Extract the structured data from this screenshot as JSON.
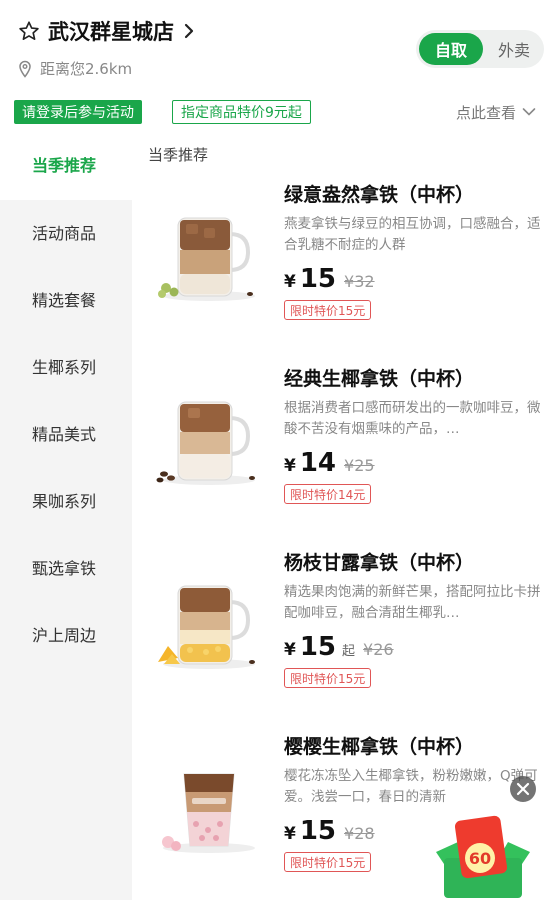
{
  "header": {
    "store_name": "武汉群星城店",
    "distance": "距离您2.6km",
    "modes": {
      "self": "自取",
      "delivery": "外卖"
    },
    "badge_login": "请登录后参与活动",
    "badge_promo": "指定商品特价9元起",
    "view_more": "点此查看"
  },
  "sidebar": {
    "items": [
      {
        "label": "当季推荐",
        "active": true
      },
      {
        "label": "活动商品"
      },
      {
        "label": "精选套餐"
      },
      {
        "label": "生椰系列"
      },
      {
        "label": "精品美式"
      },
      {
        "label": "果咖系列"
      },
      {
        "label": "甄选拿铁"
      },
      {
        "label": "沪上周边"
      }
    ]
  },
  "section_title": "当季推荐",
  "products": [
    {
      "name": "绿意盎然拿铁（中杯）",
      "desc": "燕麦拿铁与绿豆的相互协调，口感融合，适合乳糖不耐症的人群",
      "currency": "¥",
      "price": "15",
      "qi": "",
      "original": "¥32",
      "tag": "限时特价15元"
    },
    {
      "name": "经典生椰拿铁（中杯）",
      "desc": "根据消费者口感而研发出的一款咖啡豆，微酸不苦没有烟熏味的产品，…",
      "currency": "¥",
      "price": "14",
      "qi": "",
      "original": "¥25",
      "tag": "限时特价14元"
    },
    {
      "name": "杨枝甘露拿铁（中杯）",
      "desc": "精选果肉饱满的新鲜芒果，搭配阿拉比卡拼配咖啡豆，融合清甜生椰乳…",
      "currency": "¥",
      "price": "15",
      "qi": "起",
      "original": "¥26",
      "tag": "限时特价15元"
    },
    {
      "name": "樱樱生椰拿铁（中杯）",
      "desc": "樱花冻冻坠入生椰拿铁，粉粉嫩嫩，Q弹可爱。浅尝一口，春日的清新",
      "currency": "¥",
      "price": "15",
      "qi": "",
      "original": "¥28",
      "tag": "限时特价15元"
    }
  ],
  "gift_badge": "60",
  "colors": {
    "accent": "#1aa64a",
    "promo_red": "#e05656"
  }
}
